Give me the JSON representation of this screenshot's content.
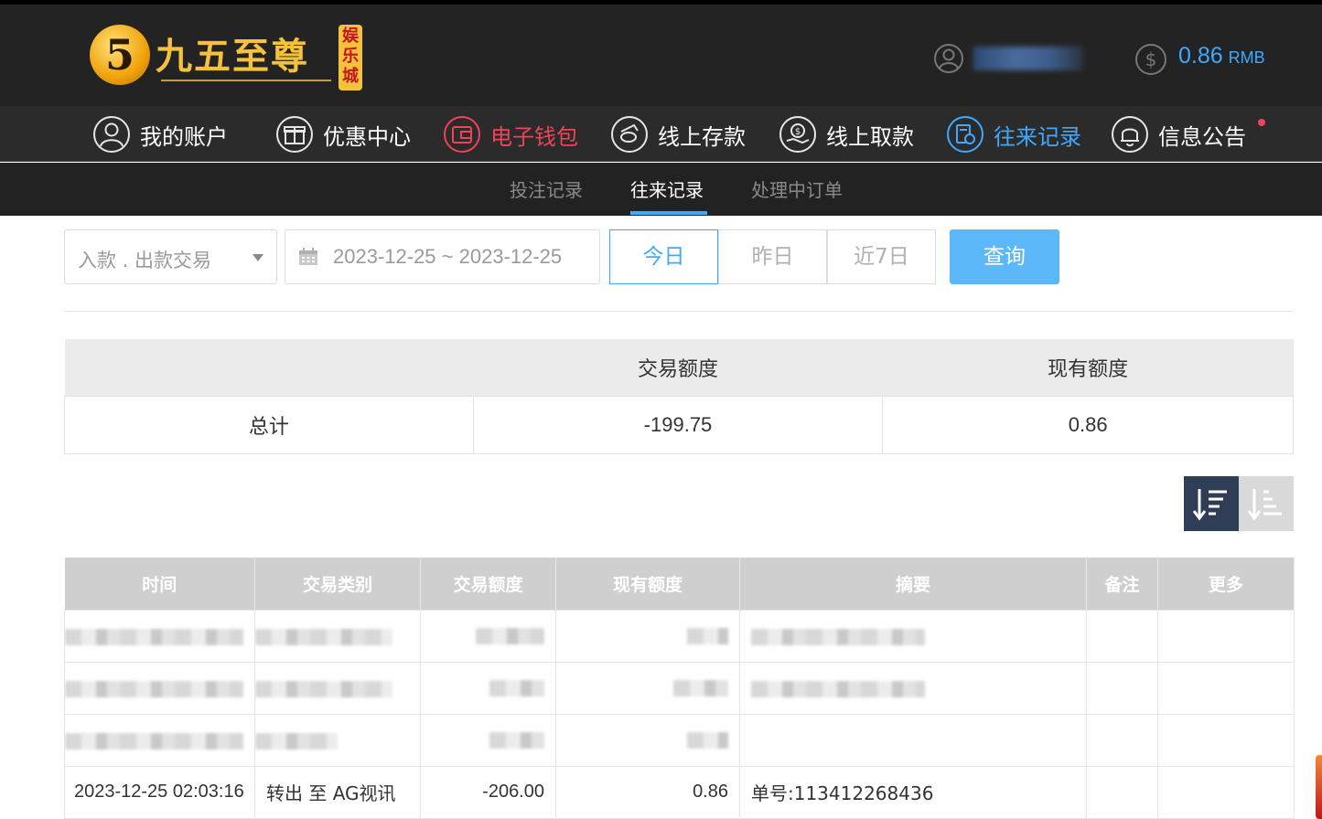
{
  "brand": {
    "badge": "5",
    "name": "九五至尊",
    "sub": "娱乐城"
  },
  "account": {
    "balance": "0.86",
    "currency": "RMB"
  },
  "nav": [
    {
      "label": "我的账户",
      "icon": "user-circle-icon"
    },
    {
      "label": "优惠中心",
      "icon": "gift-icon"
    },
    {
      "label": "电子钱包",
      "icon": "wallet-icon"
    },
    {
      "label": "线上存款",
      "icon": "deposit-icon"
    },
    {
      "label": "线上取款",
      "icon": "withdraw-icon"
    },
    {
      "label": "往来记录",
      "icon": "records-icon"
    },
    {
      "label": "信息公告",
      "icon": "bell-icon"
    }
  ],
  "subnav": [
    {
      "label": "投注记录"
    },
    {
      "label": "往来记录"
    },
    {
      "label": "处理中订单"
    }
  ],
  "filters": {
    "type_select": "入款 . 出款交易",
    "date_range": "2023-12-25 ~ 2023-12-25",
    "quick": [
      "今日",
      "昨日",
      "近7日"
    ],
    "query": "查询"
  },
  "summary": {
    "headers": [
      "",
      "交易额度",
      "现有额度"
    ],
    "row": {
      "label": "总计",
      "amount": "-199.75",
      "balance": "0.86"
    }
  },
  "records": {
    "headers": [
      "时间",
      "交易类别",
      "交易额度",
      "现有额度",
      "摘要",
      "备注",
      "更多"
    ],
    "rows": [
      {
        "time": "2023-12-25 02:03:16",
        "type": "转出 至 AG视讯",
        "amount": "-206.00",
        "balance": "0.86",
        "summary": "单号:113412268436",
        "note": "",
        "more": ""
      }
    ]
  },
  "colors": {
    "accent_blue": "#3fa9ff",
    "accent_red": "#f0435a",
    "header_bg": "#232323",
    "sort_active": "#2f3e55"
  }
}
